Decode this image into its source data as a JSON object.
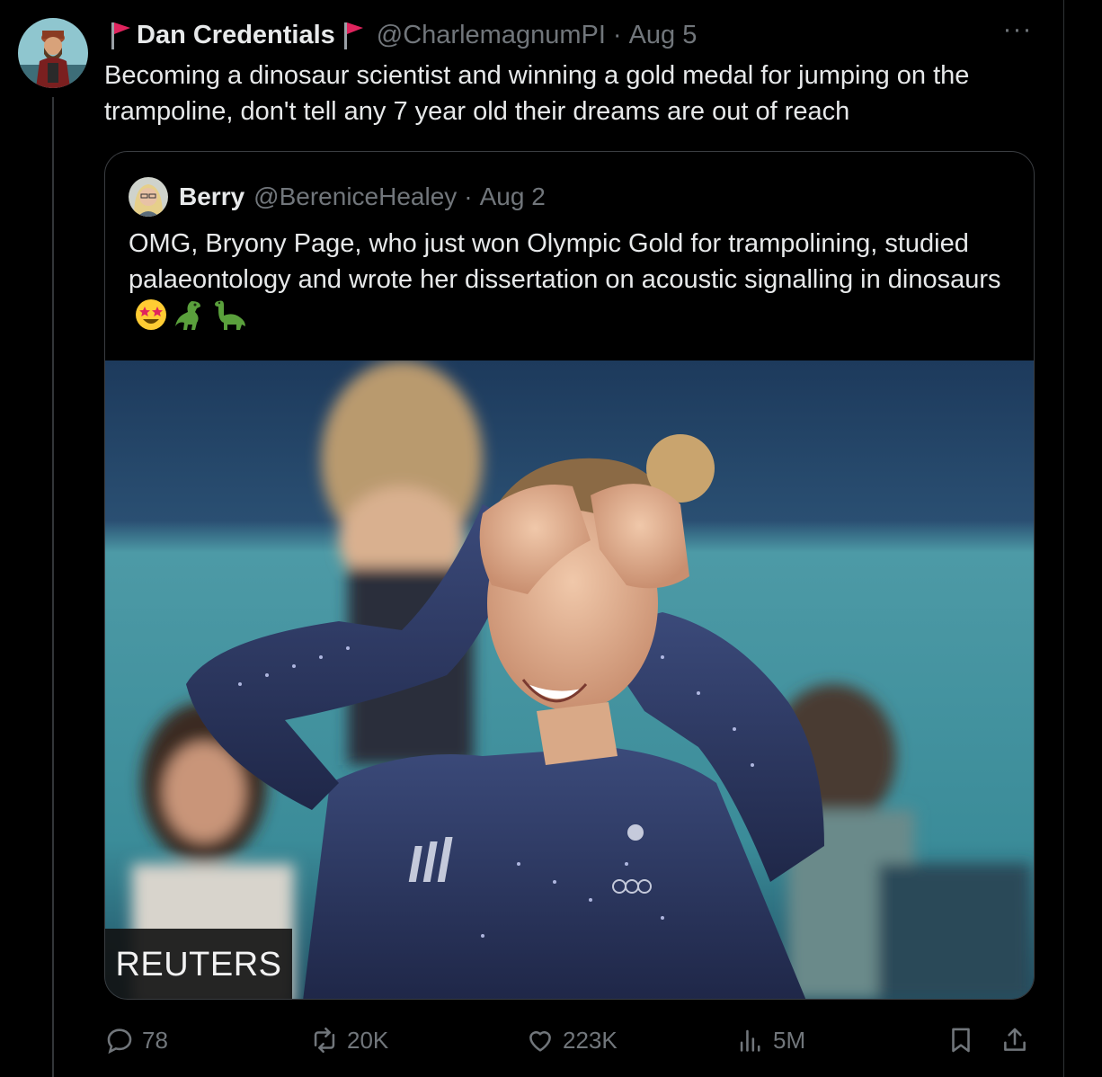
{
  "tweet": {
    "author_name": "Dan Credentials",
    "handle": "@CharlemagnumPI",
    "separator": "·",
    "date": "Aug 5",
    "text": "Becoming a dinosaur scientist and winning a gold medal for jumping on the trampoline, don't tell any 7 year old their dreams are out of reach",
    "more_label": "···"
  },
  "quote": {
    "author_name": "Berry",
    "handle": "@BereniceHealey",
    "separator": "·",
    "date": "Aug 2",
    "text": "OMG, Bryony Page, who just won Olympic Gold for trampolining, studied palaeontology and wrote her dissertation on acoustic signalling in dinosaurs",
    "emojis": [
      "star-struck",
      "t-rex",
      "sauropod"
    ],
    "photo_credit": "REUTERS"
  },
  "actions": {
    "replies": "78",
    "reposts": "20K",
    "likes": "223K",
    "views": "5M"
  },
  "colors": {
    "background": "#000000",
    "text": "#e7e9ea",
    "muted": "#71767b",
    "border": "#2f3336",
    "flag": "#e0245e"
  }
}
